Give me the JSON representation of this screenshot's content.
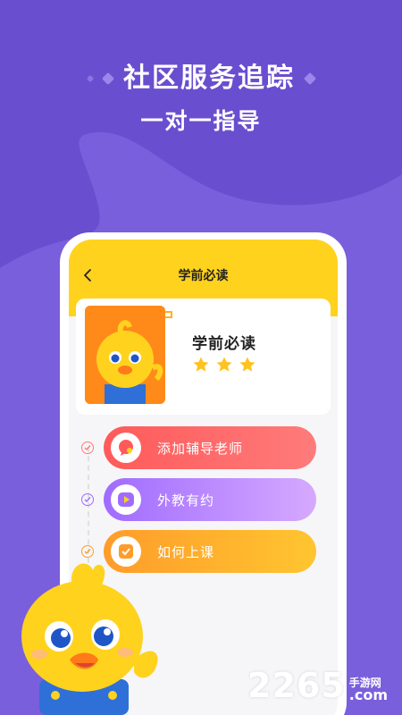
{
  "promo": {
    "headline_line1": "社区服务追踪",
    "headline_line2": "一对一指导"
  },
  "app": {
    "topbar_title": "学前必读",
    "course": {
      "title": "学前必读",
      "stars": 3
    },
    "steps": [
      {
        "label": "添加辅导老师",
        "icon": "chat-icon",
        "color": "#ff5a5a"
      },
      {
        "label": "外教有约",
        "icon": "play-icon",
        "color": "#a06cff"
      },
      {
        "label": "如何上课",
        "icon": "check-icon",
        "color": "#ff9c2a"
      }
    ]
  },
  "watermark": {
    "number": "2265",
    "site_cn": "手游网",
    "domain": ".com"
  },
  "colors": {
    "background": "#6a4ed0",
    "accent_yellow": "#ffd21e"
  }
}
